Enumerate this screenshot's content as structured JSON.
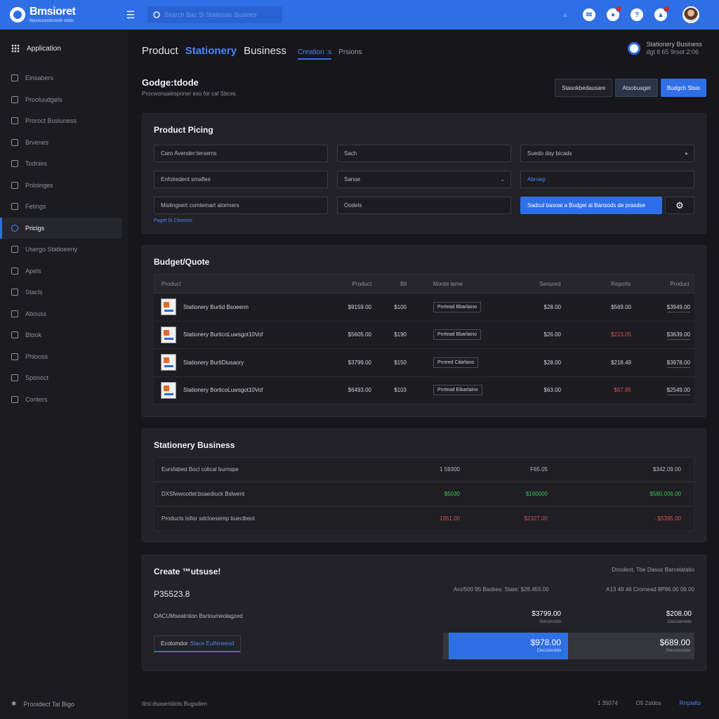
{
  "topbar": {
    "logo_title": "Bmsioret",
    "logo_sub": "Bipsicurestensolb stebs",
    "search_placeholder": "Search Bac Si Stationas Busines"
  },
  "sidebar": {
    "app_label": "Application",
    "items": [
      {
        "label": "Einsabers"
      },
      {
        "label": "Prooluudgels"
      },
      {
        "label": "Proroct Busiuness"
      },
      {
        "label": "Brvenes"
      },
      {
        "label": "Todnies"
      },
      {
        "label": "Pnloinges"
      },
      {
        "label": "Fetings"
      },
      {
        "label": "Pricigs"
      },
      {
        "label": "Usergo Statioeeny"
      },
      {
        "label": "Apels"
      },
      {
        "label": "Stacls"
      },
      {
        "label": "Abouss"
      },
      {
        "label": "Btook"
      },
      {
        "label": "Phlooss"
      },
      {
        "label": "Sponoct"
      },
      {
        "label": "Conters"
      }
    ],
    "bottom_label": "Prooidect Tai Bigo"
  },
  "header": {
    "crumb1": "Product",
    "crumb2": "Stationery",
    "crumb3": "Business",
    "tab_active": "Creation :s",
    "tab_other": "Prsions",
    "status_line1": "Stationery Business",
    "status_line2": "dgt lt 65 9rsot 2:06"
  },
  "page": {
    "title": "Godge:tdode",
    "subtitle": "Procwonsaiespriner exo for cal Sbces",
    "btn1": "Stasokbedausare",
    "btn2": "Atsobuaget",
    "btn3": "Budgch Stsio"
  },
  "pricing": {
    "title": "Product Picing",
    "f1": "Caro Avender:tersems",
    "f2": "Sach",
    "f3": "Suedo day bicads",
    "f4": "Enfolredent smafles",
    "f5": "Sanoe",
    "f6": "Abroep",
    "f7": "Mislingsert comtemart alormers",
    "f8": "Oodels",
    "action_btn": "Sadcul basoai a Budget al Bansods de prasdse",
    "link": "Paget Si Chonres"
  },
  "budget": {
    "title": "Budget/Quote",
    "headers": [
      "Product",
      "Product",
      "Bil",
      "Moote lame",
      "Senured",
      "Reports",
      "Product"
    ],
    "rows": [
      {
        "name": "Stationery Burtid Bsoeenn",
        "price": "$9159.00",
        "bill": "$100",
        "mode": "Pnrtead Bbarlaino",
        "sec": "$28.00",
        "rep": "$569.00",
        "last": "$3949.00",
        "rep_neg": false
      },
      {
        "name": "Stationery BurticoLuwsgot10Vof",
        "price": "$5605.00",
        "bill": "$190",
        "mode": "Pnrtead Bbarlaino",
        "sec": "$26.00",
        "rep": "$223.05",
        "last": "$3639.00",
        "rep_neg": true
      },
      {
        "name": "Stationery BurtiDiusaory",
        "price": "$3799.00",
        "bill": "$150",
        "mode": "Pnreed Cilarlano",
        "sec": "$28.00",
        "rep": "$218.49",
        "last": "$3978.00",
        "rep_neg": false
      },
      {
        "name": "Stationery BorticoLuwsgot10Vof",
        "price": "$6493.00",
        "bill": "$103",
        "mode": "Pnrtead Eibarlaino",
        "sec": "$63.00",
        "rep": "$57.85",
        "last": "$2549.00",
        "rep_neg": true
      }
    ]
  },
  "business": {
    "title": "Stationery Business",
    "rows": [
      {
        "label": "Eursfabed Bocl colical burnspe",
        "v1": "1 59300",
        "v2": "F65.05",
        "v3": "$342.09.00",
        "tone": "plain"
      },
      {
        "label": "DXSfwwoottel:bsaediuck Bslwent",
        "v1": "$5030",
        "v2": "$160000",
        "v3": "$580.006.00",
        "tone": "pos"
      },
      {
        "label": "Products Isfior sdcloesemp bueclbeot",
        "v1": "1951.00",
        "v2": "$2327.00",
        "v3": "- $5395.00",
        "tone": "neg"
      }
    ]
  },
  "create": {
    "title": "Create ™utsuse!",
    "right_note": "Drooleot, Tbe Dasoc Barcelatatio",
    "amount": "P35523.8",
    "line_a": "Aro/500 95 Basbes: State: $28.455.00",
    "line_b": "A13 49 46 Cromead 8P86.00 09.00",
    "line_c": "OACUMseatntion Bsrtoumeolagzed",
    "s1_val": "$3799.00",
    "s1_sub": "Stecsinoldo",
    "s2_val": "$208.00",
    "s2_sub": "Clecslanoldo",
    "ecom_label": "Ecotomdor",
    "ecom_blue": "Stace Euthineesd",
    "t1_val": "$978.00",
    "t1_sub": "Clecsioeoldo",
    "t2_val": "$689.00",
    "t2_sub": "Stecsionoldo"
  },
  "footer": {
    "left": "Itrsi:dsaseridiols Bugsdien",
    "r1": "1 35074",
    "r2": "O5 2sldos",
    "r3": "Rrrplalto"
  }
}
